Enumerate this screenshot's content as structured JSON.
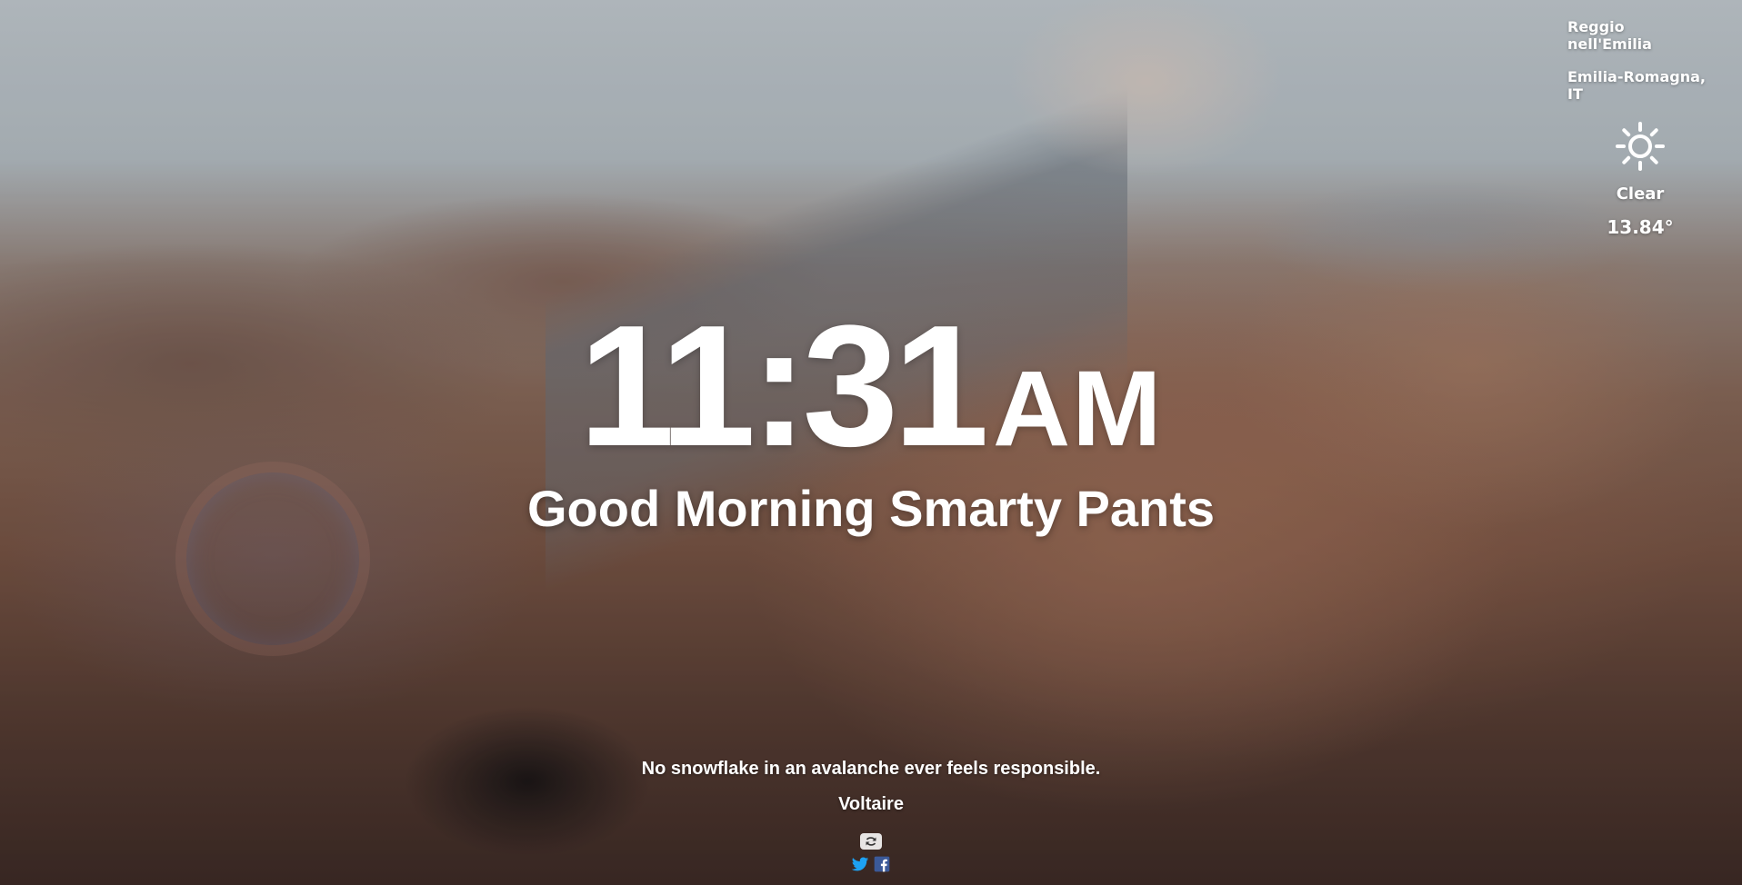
{
  "weather": {
    "city": "Reggio nell'Emilia",
    "region": "Emilia-Romagna, IT",
    "icon": "sun-icon",
    "condition": "Clear",
    "temperature": "13.84°"
  },
  "clock": {
    "time": "11:31",
    "ampm": "AM"
  },
  "greeting": "Good Morning Smarty Pants",
  "quote": {
    "text": "No snowflake in an avalanche ever feels responsible.",
    "author": "Voltaire"
  },
  "actions": {
    "refresh_icon": "refresh-icon",
    "twitter_icon": "twitter-icon",
    "facebook_icon": "facebook-icon",
    "twitter_color": "#1da1f2",
    "facebook_color": "#3b5998"
  }
}
